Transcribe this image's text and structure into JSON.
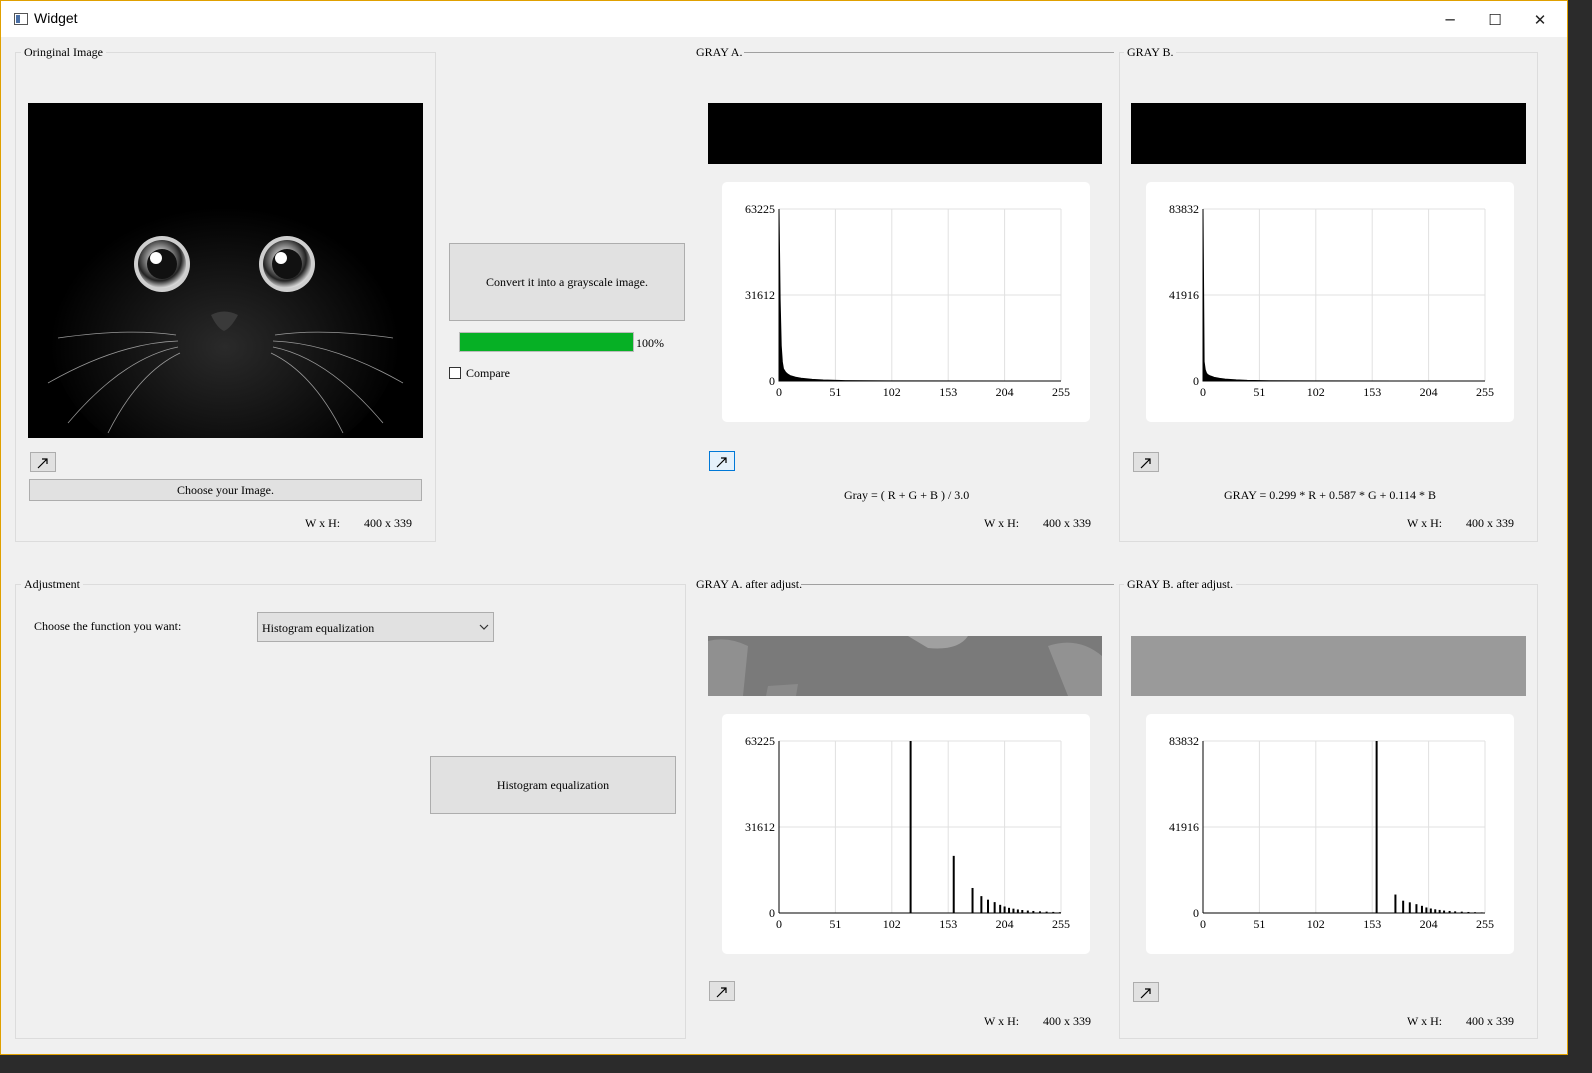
{
  "window": {
    "title": "Widget",
    "minimize_glyph": "─",
    "maximize_glyph": "☐",
    "close_glyph": "✕"
  },
  "original": {
    "group_title": "Oringinal Image",
    "choose_button": "Choose your Image.",
    "wh_label": "W x H:",
    "wh_value": "400 x 339"
  },
  "convert": {
    "button_label": "Convert it into a grayscale image.",
    "progress": 1.0,
    "progress_text": "100%",
    "compare_label": "Compare",
    "compare_checked": false
  },
  "gray_a": {
    "group_title": "GRAY A.",
    "formula": "Gray = ( R + G + B ) / 3.0",
    "wh_label": "W x H:",
    "wh_value": "400 x 339"
  },
  "gray_b": {
    "group_title": "GRAY B.",
    "formula": "GRAY = 0.299 * R + 0.587 * G + 0.114 * B",
    "wh_label": "W x H:",
    "wh_value": "400 x 339"
  },
  "adjustment": {
    "group_title": "Adjustment",
    "choose_label": "Choose the function you want:",
    "selected_function": "Histogram equalization",
    "apply_button": "Histogram equalization"
  },
  "gray_a_adj": {
    "group_title": "GRAY A. after adjust.",
    "wh_label": "W x H:",
    "wh_value": "400 x 339"
  },
  "gray_b_adj": {
    "group_title": "GRAY B. after adjust.",
    "wh_label": "W x H:",
    "wh_value": "400 x 339"
  },
  "icons": [
    "window-app-icon",
    "expand-arrow-icon",
    "chevron-down-icon"
  ],
  "colors": {
    "progress": "#06b025",
    "focus": "#0078d7"
  },
  "chart_data": [
    {
      "type": "area",
      "title": "GRAY A.",
      "x_ticks": [
        0,
        51,
        102,
        153,
        204,
        255
      ],
      "y_ticks": [
        0,
        31612,
        63225
      ],
      "xlim": [
        0,
        255
      ],
      "ylim": [
        0,
        63225
      ],
      "grid": true,
      "x": [
        0,
        1,
        2,
        3,
        4,
        6,
        8,
        10,
        15,
        20,
        30,
        40,
        60,
        100,
        255
      ],
      "values": [
        63225,
        30000,
        13000,
        7000,
        4500,
        3200,
        2500,
        2000,
        1400,
        1000,
        600,
        350,
        150,
        50,
        0
      ]
    },
    {
      "type": "area",
      "title": "GRAY B.",
      "x_ticks": [
        0,
        51,
        102,
        153,
        204,
        255
      ],
      "y_ticks": [
        0,
        41916,
        83832
      ],
      "xlim": [
        0,
        255
      ],
      "ylim": [
        0,
        83832
      ],
      "grid": true,
      "x": [
        0,
        1,
        2,
        3,
        4,
        6,
        8,
        10,
        15,
        20,
        30,
        40,
        60,
        100,
        255
      ],
      "values": [
        83832,
        9500,
        5500,
        4000,
        3200,
        2600,
        2200,
        1800,
        1300,
        900,
        550,
        320,
        140,
        40,
        0
      ]
    },
    {
      "type": "bar",
      "title": "GRAY A. after adjust.",
      "x_ticks": [
        0,
        51,
        102,
        153,
        204,
        255
      ],
      "y_ticks": [
        0,
        31612,
        63225
      ],
      "xlim": [
        0,
        255
      ],
      "ylim": [
        0,
        63225
      ],
      "grid": true,
      "x": [
        119,
        158,
        175,
        183,
        189,
        195,
        200,
        204,
        208,
        212,
        216,
        220,
        225,
        230,
        236,
        242,
        248,
        254
      ],
      "values": [
        63225,
        21000,
        9200,
        6200,
        4900,
        4000,
        3000,
        2400,
        1900,
        1600,
        1300,
        1100,
        900,
        750,
        600,
        500,
        400,
        300
      ]
    },
    {
      "type": "bar",
      "title": "GRAY B. after adjust.",
      "x_ticks": [
        0,
        51,
        102,
        153,
        204,
        255
      ],
      "y_ticks": [
        0,
        41916,
        83832
      ],
      "xlim": [
        0,
        255
      ],
      "ylim": [
        0,
        83832
      ],
      "grid": true,
      "x": [
        157,
        174,
        181,
        187,
        193,
        198,
        202,
        206,
        210,
        214,
        218,
        223,
        228,
        234,
        240,
        246,
        252
      ],
      "values": [
        83832,
        9000,
        6000,
        5200,
        4300,
        3500,
        2700,
        2200,
        1800,
        1500,
        1200,
        1000,
        800,
        650,
        500,
        400,
        300
      ]
    }
  ]
}
